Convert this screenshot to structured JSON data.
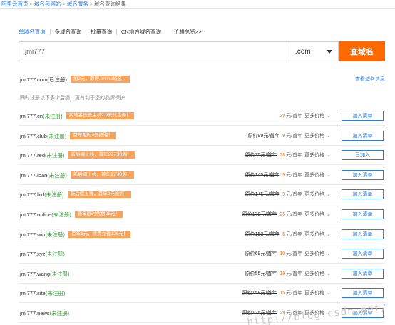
{
  "breadcrumb": {
    "items": [
      "阿里云首页",
      "域名与网站",
      "域名服务",
      "域名查询结果"
    ]
  },
  "tabs": [
    "单域名查询",
    "多域名查询",
    "批量查询",
    "CN地方域名查询",
    "价格总览>>"
  ],
  "search": {
    "value": "jmi777",
    "tld": ".com",
    "button": "查域名"
  },
  "main_result": {
    "domain": "jmi777.com(已注册)",
    "tag": "加2元，即得.online域名！",
    "whois": "查看域名信息"
  },
  "hint": "同时注册以下多个后缀，更有利于您的品牌保护",
  "rows": [
    {
      "name": "jmi777.cn",
      "status": "(未注册)",
      "tag": "买域名送云主机7.9元代金券！",
      "orig": "",
      "price": "29",
      "unit": "元/首年",
      "more": "更多价格",
      "btn": "加入清单"
    },
    {
      "name": "jmi777.club",
      "status": "(未注册)",
      "tag": "首年限时9元抢购！",
      "orig": "原价99元/首年",
      "price": "9",
      "unit": "元/首年",
      "more": "更多价格",
      "btn": "加入清单"
    },
    {
      "name": "jmi777.red",
      "status": "(未注册)",
      "tag": "新后缀上线，首年28元抢购！",
      "orig": "原价75元/首年",
      "price": "28",
      "unit": "元/首年",
      "more": "更多价格",
      "btn": "已加入"
    },
    {
      "name": "jmi777.loan",
      "status": "(未注册)",
      "tag": "新后缀上线，首年9元抢购！",
      "orig": "原价145元/首年",
      "price": "9",
      "unit": "元/首年",
      "more": "更多价格",
      "btn": "加入清单"
    },
    {
      "name": "jmi777.bid",
      "status": "(未注册)",
      "tag": "新后缀上线，首年9元抢购！",
      "orig": "原价145元/首年",
      "price": "9",
      "unit": "元/首年",
      "more": "更多价格",
      "btn": "加入清单"
    },
    {
      "name": "jmi777.online",
      "status": "(未注册)",
      "tag": "新年限时优惠25元！",
      "orig": "原价179元/首年",
      "price": "25",
      "unit": "元/首年",
      "more": "更多价格",
      "btn": "加入清单"
    },
    {
      "name": "jmi777.win",
      "status": "(未注册)",
      "tag": "首年6元，续费立省126元！",
      "orig": "原价153元/首年",
      "price": "6",
      "unit": "元/首年",
      "more": "更多价格",
      "btn": "加入清单"
    },
    {
      "name": "jmi777.xyz",
      "status": "(未注册)",
      "tag": "",
      "orig": "原价69元/首年",
      "price": "10",
      "unit": "元/首年",
      "more": "更多价格",
      "btn": "加入清单"
    },
    {
      "name": "jmi777.wang",
      "status": "(未注册)",
      "tag": "",
      "orig": "原价55元/首年",
      "price": "19",
      "unit": "元/首年",
      "more": "更多价格",
      "btn": "加入清单"
    },
    {
      "name": "jmi777.site",
      "status": "(未注册)",
      "tag": "",
      "orig": "原价158元/首年",
      "price": "15",
      "unit": "元/首年",
      "more": "更多价格",
      "btn": "加入清单"
    },
    {
      "name": "jmi777.news",
      "status": "(未注册)",
      "tag": "",
      "orig": "原价125元/首年",
      "price": "29",
      "unit": "元/首年",
      "more": "更多价格",
      "btn": "加入清单"
    }
  ],
  "watermark": "http://blog.csdn.net/",
  "colors": {
    "accent": "#2a7ae2",
    "brand": "#ff6a00",
    "tag": "#f7a35c",
    "available": "#3a9a3a"
  }
}
